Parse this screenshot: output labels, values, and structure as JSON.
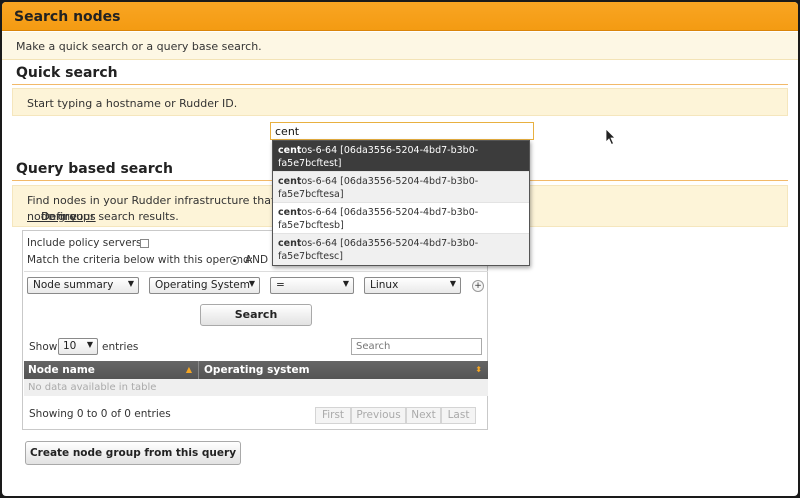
{
  "page": {
    "title": "Search nodes",
    "intro": "Make a quick search or a query base search."
  },
  "quick_search": {
    "title": "Quick search",
    "hint": "Start typing a hostname or Rudder ID.",
    "input_value": "cent",
    "suggestions": [
      {
        "match": "cent",
        "rest_line1": "os-6-64 [06da3556-5204-4bd7-b3b0-",
        "line2": "fa5e7bcftest]"
      },
      {
        "match": "cent",
        "rest_line1": "os-6-64 [06da3556-5204-4bd7-b3b0-",
        "line2": "fa5e7bcftesa]"
      },
      {
        "match": "cent",
        "rest_line1": "os-6-64 [06da3556-5204-4bd7-b3b0-",
        "line2": "fa5e7bcftesb]"
      },
      {
        "match": "cent",
        "rest_line1": "os-6-64 [06da3556-5204-4bd7-b3b0-",
        "line2": "fa5e7bcftesc]"
      }
    ]
  },
  "query_search": {
    "title": "Query based search",
    "hint_line1": "Find nodes in your Rudder infrastructure that matc",
    "hint_line2_prefix": "Define ",
    "hint_line2_link": "node groups",
    "hint_line2_suffix": " from your search results.",
    "include_policy_servers_label": "Include policy servers:",
    "match_label": "Match the criteria below with this operand:",
    "operand_value": "AND",
    "criteria": {
      "object": "Node summary",
      "attribute": "Operating System",
      "comparator": "=",
      "value": "Linux",
      "add_symbol": "+"
    },
    "search_button": "Search",
    "table": {
      "show_label": "Show",
      "page_size": "10",
      "entries_label": "entries",
      "filter_placeholder": "Search",
      "columns": [
        "Node name",
        "Operating system"
      ],
      "empty_message": "No data available in table",
      "info": "Showing 0 to 0 of 0 entries",
      "pager": [
        "First",
        "Previous",
        "Next",
        "Last"
      ]
    },
    "create_group_button": "Create node group from this query"
  },
  "colors": {
    "title_bar": "#f49b12",
    "hint_bg": "#fdf4d8",
    "active_suggestion": "#3c3c3c"
  }
}
